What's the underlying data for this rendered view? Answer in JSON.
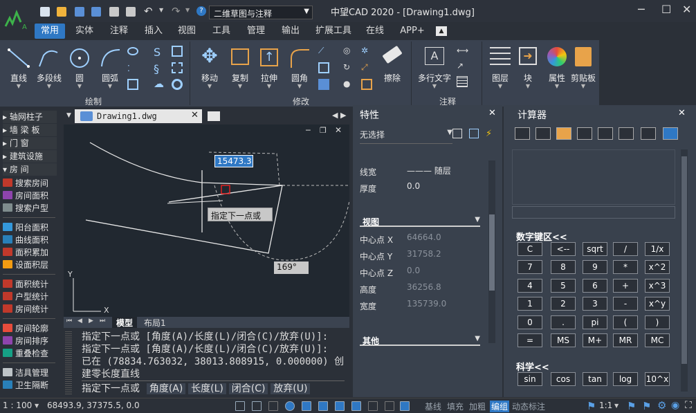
{
  "title_bar": {
    "app_title": "中望CAD 2020 - [Drawing1.dwg]",
    "workspace": "二维草图与注释"
  },
  "ribbon_tabs": [
    "常用",
    "实体",
    "注释",
    "插入",
    "视图",
    "工具",
    "管理",
    "输出",
    "扩展工具",
    "在线",
    "APP+"
  ],
  "ribbon": {
    "draw_tools": [
      "直线",
      "多段线",
      "圆",
      "圆弧"
    ],
    "draw_group": "绘制",
    "modify_tools": [
      "移动",
      "复制",
      "拉伸",
      "圆角",
      "擦除"
    ],
    "modify_group": "修改",
    "annot_tools": [
      "多行文字"
    ],
    "annot_group": "注释",
    "other_tools": [
      "图层",
      "块",
      "属性",
      "剪贴板"
    ]
  },
  "left_palette": {
    "headers": [
      "轴网柱子",
      "墙 梁 板",
      "门    窗",
      "建筑设施",
      "房    间"
    ],
    "items": [
      "搜索房间",
      "房间面积",
      "搜索户型",
      "阳台面积",
      "曲线面积",
      "面积累加",
      "设面积层",
      "面积统计",
      "户型统计",
      "房间统计",
      "房间轮廓",
      "房间排序",
      "重叠检查",
      "洁具管理",
      "卫生隔断"
    ]
  },
  "document": {
    "tab": "Drawing1.dwg",
    "layout_tabs": [
      "模型",
      "布局1"
    ],
    "input_value": "15473.3",
    "tooltip": "指定下一点或",
    "angle": "169°",
    "axis_x": "X",
    "axis_y": "Y"
  },
  "command": {
    "lines": [
      "指定下一点或 [角度(A)/长度(L)/闭合(C)/放弃(U)]:",
      "指定下一点或 [角度(A)/长度(L)/闭合(C)/放弃(U)]:",
      "已在 (78834.763032, 38013.808915, 0.000000) 创",
      "建零长度直线"
    ],
    "prompt": "指定下一点或",
    "options": [
      "角度(A)",
      "长度(L)",
      "闭合(C)",
      "放弃(U)"
    ]
  },
  "properties": {
    "title": "特性",
    "selection": "无选择",
    "rows": [
      {
        "label": "线宽",
        "value": "——— 随层"
      },
      {
        "label": "厚度",
        "value": "0.0"
      }
    ],
    "view_section": "视图",
    "view_rows": [
      {
        "label": "中心点 X",
        "value": "64664.0"
      },
      {
        "label": "中心点 Y",
        "value": "31758.2"
      },
      {
        "label": "中心点 Z",
        "value": "0.0"
      },
      {
        "label": "高度",
        "value": "36256.8"
      },
      {
        "label": "宽度",
        "value": "135739.0"
      }
    ],
    "other_section": "其他"
  },
  "calculator": {
    "title": "计算器",
    "keypad_label": "数字键区<<",
    "keys": [
      [
        "C",
        "<--",
        "sqrt",
        "/",
        "1/x"
      ],
      [
        "7",
        "8",
        "9",
        "*",
        "x^2"
      ],
      [
        "4",
        "5",
        "6",
        "+",
        "x^3"
      ],
      [
        "1",
        "2",
        "3",
        "-",
        "x^y"
      ],
      [
        "0",
        ".",
        "pi",
        "(",
        ")"
      ],
      [
        "=",
        "MS",
        "M+",
        "MR",
        "MC"
      ]
    ],
    "sci_label": "科学<<",
    "sci_keys": [
      "sin",
      "cos",
      "tan",
      "log",
      "10^x"
    ]
  },
  "status": {
    "scale": "1 : 100",
    "coords": "68493.9, 37375.5, 0.0",
    "words": [
      "基线",
      "填充",
      "加粗",
      "编组",
      "动态标注"
    ],
    "zoom": "1:1"
  },
  "colors": {
    "accent": "#2f78c4",
    "ribbon_bg": "#3a4250",
    "panel_bg": "#39414d",
    "canvas_bg": "#212830"
  }
}
